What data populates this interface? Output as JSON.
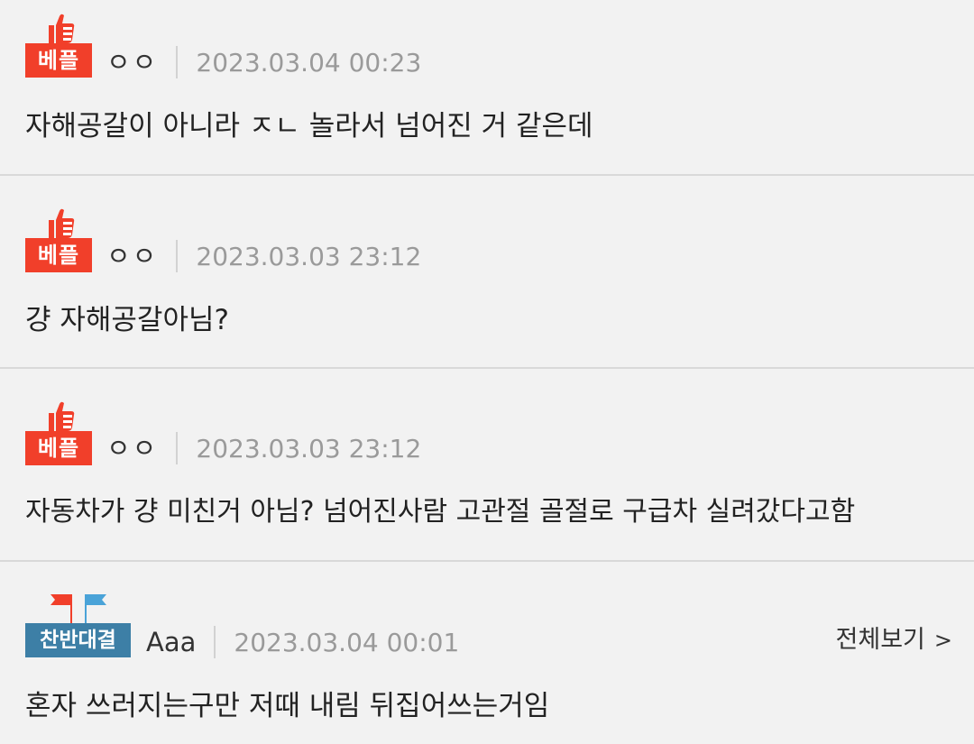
{
  "comments": [
    {
      "badge": "베플",
      "author": "ㅇㅇ",
      "date": "2023.03.04 00:23",
      "text": "자해공갈이 아니라 ㅈㄴ 놀라서 넘어진 거 같은데"
    },
    {
      "badge": "베플",
      "author": "ㅇㅇ",
      "date": "2023.03.03 23:12",
      "text": "걍 자해공갈아님?"
    },
    {
      "badge": "베플",
      "author": "ㅇㅇ",
      "date": "2023.03.03 23:12",
      "text": "자동차가 걍 미친거 아님? 넘어진사람 고관절 골절로 구급차 실려갔다고함"
    },
    {
      "badge": "찬반대결",
      "author": "Aaa",
      "date": "2023.03.04 00:01",
      "text": "혼자 쓰러지는구만 저때 내림 뒤집어쓰는거임",
      "view_all": "전체보기",
      "view_all_chevron": ">"
    }
  ],
  "colors": {
    "best_badge": "#f13f2a",
    "debate_badge": "#3d7fa6",
    "background": "#f2f2f2",
    "date_text": "#9a9a9a"
  },
  "icons": {
    "best": "thumbs-up-icon",
    "debate": "red-blue-flags-icon"
  }
}
